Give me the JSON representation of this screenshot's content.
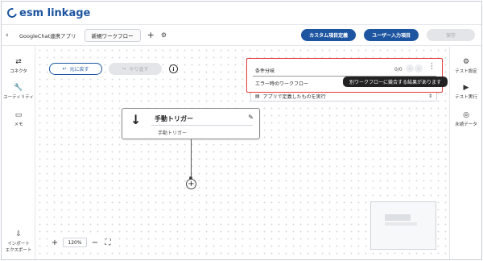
{
  "brand": {
    "name": "esm linkage"
  },
  "toolbar": {
    "back_icon": "chevron-left-icon",
    "app_name": "GoogleChat連携アプリ",
    "workflow_tab": "新規ワークフロー",
    "custom_fields_button": "カスタム項目定義",
    "user_input_button": "ユーザー入力項目",
    "save_button": "保存"
  },
  "left_rail": {
    "items": [
      {
        "label": "コネクタ",
        "icon": "transfer-icon"
      },
      {
        "label": "ユーティリティ",
        "icon": "wrench-icon"
      },
      {
        "label": "メモ",
        "icon": "comment-icon"
      }
    ],
    "bottom_item": {
      "label_line1": "インポート",
      "label_line2": "エクスポート",
      "icon": "import-export-icon"
    }
  },
  "right_rail": {
    "items": [
      {
        "label": "テスト設定",
        "icon": "gear-icon"
      },
      {
        "label": "テスト実行",
        "icon": "play-icon"
      },
      {
        "label": "永続データ",
        "icon": "database-icon"
      }
    ]
  },
  "canvas": {
    "undo_label": "元に戻す",
    "redo_label": "やり直す",
    "trigger_node": {
      "title": "手動トリガー",
      "subtitle": "手動トリガー"
    },
    "zoom_level": "120%"
  },
  "search": {
    "value": "条件分岐",
    "count": "0/0",
    "error_workflow_label": "エラー時のワークフロー",
    "tooltip": "別ワークフローに競合する結果があります"
  },
  "right_panel": {
    "select_value": "アプリで定義したものを実行"
  },
  "colors": {
    "primary": "#1d55a0",
    "highlight_border": "#e53935"
  }
}
